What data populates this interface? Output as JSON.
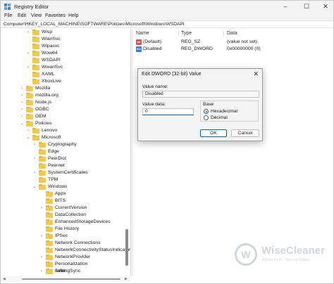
{
  "window": {
    "title": "Registry Editor",
    "controls": {
      "minimize": "–",
      "maximize": "☐",
      "close": "✕"
    }
  },
  "menu": [
    "File",
    "Edit",
    "View",
    "Favorites",
    "Help"
  ],
  "address": "Computer\\HKEY_LOCAL_MACHINE\\SOFTWARE\\Policies\\Microsoft\\Windows\\WSDAPI",
  "tree": [
    {
      "label": "Wisp",
      "expander": "›"
    },
    {
      "label": "WlanSvc",
      "expander": ""
    },
    {
      "label": "Wlpasvc",
      "expander": ""
    },
    {
      "label": "Wow64",
      "expander": "›"
    },
    {
      "label": "WSDAPI",
      "expander": ""
    },
    {
      "label": "WwanSvc",
      "expander": "›"
    },
    {
      "label": "XAML",
      "expander": ""
    },
    {
      "label": "XboxLive",
      "expander": ""
    },
    {
      "label": "Mozilla",
      "expander": "›"
    },
    {
      "label": "mozilla.org",
      "expander": "›"
    },
    {
      "label": "Node.js",
      "expander": "›"
    },
    {
      "label": "ODBC",
      "expander": "›"
    },
    {
      "label": "OEM",
      "expander": "›"
    },
    {
      "label": "Policies",
      "expander": "⌄"
    },
    {
      "label": "Lenovo",
      "expander": "›"
    },
    {
      "label": "Microsoft",
      "expander": "⌄"
    },
    {
      "label": "Cryptography",
      "expander": "›"
    },
    {
      "label": "Edge",
      "expander": ""
    },
    {
      "label": "PeerDist",
      "expander": "›"
    },
    {
      "label": "Peernet",
      "expander": ""
    },
    {
      "label": "SystemCertificates",
      "expander": "›"
    },
    {
      "label": "TPM",
      "expander": ""
    },
    {
      "label": "Windows",
      "expander": "⌄"
    },
    {
      "label": "Appx",
      "expander": ""
    },
    {
      "label": "BITS",
      "expander": ""
    },
    {
      "label": "CurrentVersion",
      "expander": "›"
    },
    {
      "label": "DataCollection",
      "expander": ""
    },
    {
      "label": "EnhancedStorageDevices",
      "expander": ""
    },
    {
      "label": "File History",
      "expander": ""
    },
    {
      "label": "IPSec",
      "expander": "›"
    },
    {
      "label": "Network Connections",
      "expander": ""
    },
    {
      "label": "NetworkConnectivityStatusIndicator",
      "expander": ""
    },
    {
      "label": "NetworkProvider",
      "expander": "›"
    },
    {
      "label": "Personalization",
      "expander": ""
    },
    {
      "label": "safer",
      "expander": "›"
    },
    {
      "label": "SettingSync",
      "expander": ""
    }
  ],
  "values_pane": {
    "columns": [
      "Name",
      "Type",
      "Data"
    ],
    "rows": [
      {
        "icon": "string-value-icon",
        "icon_text": "ab",
        "name": "(Default)",
        "type": "REG_SZ",
        "data": "(value not set)"
      },
      {
        "icon": "dword-value-icon",
        "icon_text": "011",
        "name": "Disabled",
        "type": "REG_DWORD",
        "data": "0x00000000 (0)"
      }
    ]
  },
  "dialog": {
    "title": "Edit DWORD (32-bit) Value",
    "close": "✕",
    "value_name_label": "Value name:",
    "value_name": "Disabled",
    "value_data_label": "Value data:",
    "value_data": "0",
    "base_label": "Base",
    "base_options": [
      "Hexadecimal",
      "Decimal"
    ],
    "base_selected": "Hexadecimal",
    "ok": "OK",
    "cancel": "Cancel"
  },
  "watermark": {
    "logo_letter": "W",
    "name": "WiseCleaner",
    "tagline": "Advanced PC Tune-up Utilities"
  },
  "colors": {
    "accent": "#0067c0",
    "folder": "#f2c94c",
    "titlebar": "#f3f3f3"
  }
}
